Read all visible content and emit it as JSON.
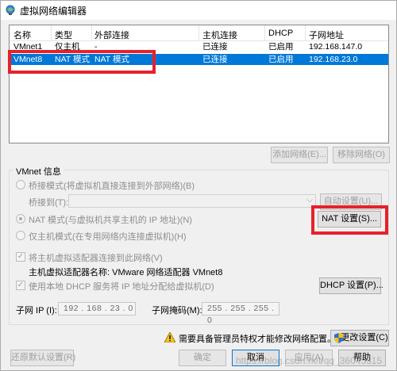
{
  "window": {
    "title": "虚拟网络编辑器"
  },
  "table": {
    "headers": [
      "名称",
      "类型",
      "外部连接",
      "主机连接",
      "DHCP",
      "子网地址"
    ],
    "rows": [
      {
        "name": "VMnet1",
        "type": "仅主机",
        "external": "-",
        "host": "已连接",
        "dhcp": "已启用",
        "subnet": "192.168.147.0"
      },
      {
        "name": "VMnet8",
        "type": "NAT 模式",
        "external": "NAT 模式",
        "host": "已连接",
        "dhcp": "已启用",
        "subnet": "192.168.23.0"
      }
    ]
  },
  "list_buttons": {
    "add": "添加网络(E)...",
    "remove": "移除网络(O)"
  },
  "vmnet_info": {
    "label": "VMnet 信息",
    "bridged": "桥接模式(将虚拟机直接连接到外部网络)(B)",
    "bridged_to": "桥接到(T):",
    "auto_settings": "自动设置(U)...",
    "nat": "NAT 模式(与虚拟机共享主机的 IP 地址)(N)",
    "nat_settings": "NAT 设置(S)...",
    "hostonly": "仅主机模式(在专用网络内连接虚拟机)(H)",
    "connect_adapter": "将主机虚拟适配器连接到此网络(V)",
    "adapter_name_label": "主机虚拟适配器名称: VMware 网络适配器 VMnet8",
    "use_dhcp": "使用本地 DHCP 服务将 IP 地址分配给虚拟机(D)",
    "dhcp_settings": "DHCP 设置(P)...",
    "subnet_ip_label": "子网 IP (I):",
    "subnet_ip": "192 . 168 . 23 . 0",
    "subnet_mask_label": "子网掩码(M):",
    "subnet_mask": "255 . 255 . 255 . 0"
  },
  "admin_notice": "需要具备管理员特权才能修改网络配置。",
  "change_settings": "更改设置(C)",
  "bottom": {
    "restore": "还原默认设置(R)",
    "ok": "确定",
    "cancel": "取消",
    "apply": "应用(A)",
    "help": "帮助"
  },
  "watermark": "https://blog.csdn.net/qq_36043315",
  "colors": {
    "selection": "#0078d7",
    "highlight_box": "#e8202a"
  }
}
